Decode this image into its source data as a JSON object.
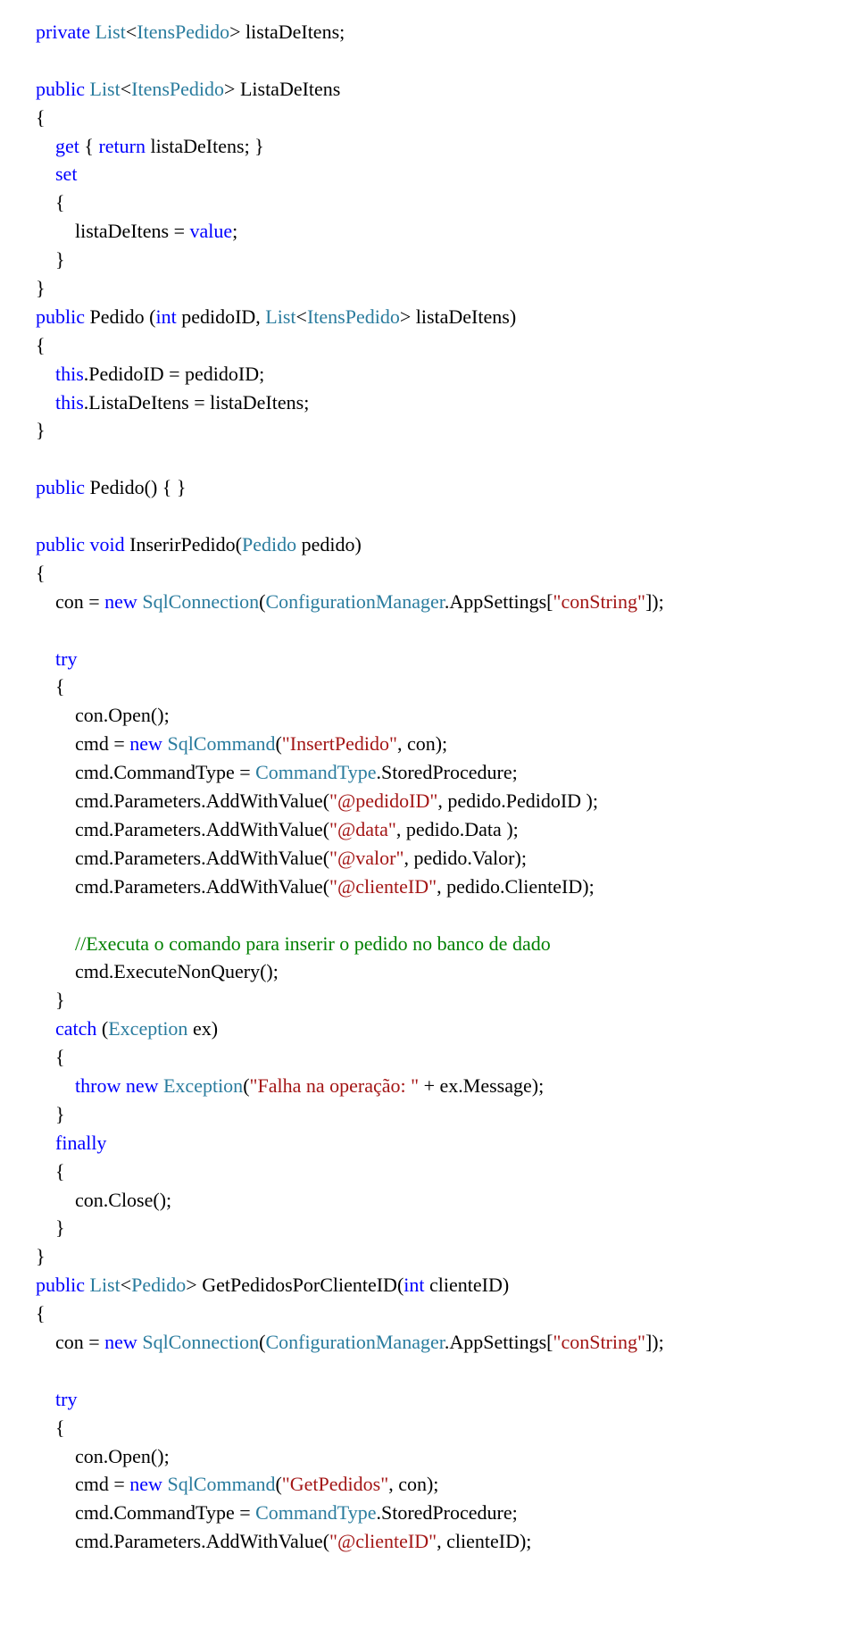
{
  "t": {
    "l1a": "private",
    "l1b": " List",
    "l1c": "<",
    "l1d": "ItensPedido",
    "l1e": "> listaDeItens; ",
    "l3a": "public",
    "l3b": " List",
    "l3c": "<",
    "l3d": "ItensPedido",
    "l3e": "> ListaDeItens ",
    "l4": "{ ",
    "l5a": "    get",
    "l5b": " { ",
    "l5c": "return",
    "l5d": " listaDeItens; } ",
    "l6a": "    set",
    "l7": "    { ",
    "l8a": "        listaDeItens = ",
    "l8b": "value",
    "l8c": "; ",
    "l9": "    } ",
    "l10": "} ",
    "l11a": "public",
    "l11b": " Pedido (",
    "l11c": "int",
    "l11d": " pedidoID, ",
    "l11e": "List",
    "l11f": "<",
    "l11g": "ItensPedido",
    "l11h": "> listaDeItens) ",
    "l12": "{ ",
    "l13a": "    this",
    "l13b": ".PedidoID = pedidoID; ",
    "l14a": "    this",
    "l14b": ".ListaDeItens = listaDeItens; ",
    "l15": "} ",
    "l17a": "public",
    "l17b": " Pedido() { } ",
    "l19a": "public",
    "l19b": " ",
    "l19c": "void",
    "l19d": " InserirPedido(",
    "l19e": "Pedido",
    "l19f": " pedido) ",
    "l20": "{ ",
    "l21a": "    con = ",
    "l21b": "new",
    "l21c": " SqlConnection",
    "l21d": "(",
    "l21e": "ConfigurationManager",
    "l21f": ".AppSettings[",
    "l21g": "\"conString\"",
    "l21h": "]); ",
    "l23a": "    try",
    "l24": "    { ",
    "l25": "        con.Open(); ",
    "l26a": "        cmd = ",
    "l26b": "new",
    "l26c": " SqlCommand",
    "l26d": "(",
    "l26e": "\"InsertPedido\"",
    "l26f": ", con); ",
    "l27a": "        cmd.CommandType = ",
    "l27b": "CommandType",
    "l27c": ".StoredProcedure; ",
    "l28a": "        cmd.Parameters.AddWithValue(",
    "l28b": "\"@pedidoID\"",
    "l28c": ", pedido.PedidoID ); ",
    "l29a": "        cmd.Parameters.AddWithValue(",
    "l29b": "\"@data\"",
    "l29c": ", pedido.Data ); ",
    "l30a": "        cmd.Parameters.AddWithValue(",
    "l30b": "\"@valor\"",
    "l30c": ", pedido.Valor); ",
    "l31a": "        cmd.Parameters.AddWithValue(",
    "l31b": "\"@clienteID\"",
    "l31c": ", pedido.ClienteID); ",
    "l33": "        //Executa o comando para inserir o pedido no banco de dado ",
    "l34": "        cmd.ExecuteNonQuery(); ",
    "l35": "    } ",
    "l36a": "    catch",
    "l36b": " (",
    "l36c": "Exception",
    "l36d": " ex) ",
    "l37": "    { ",
    "l38a": "        throw",
    "l38b": " ",
    "l38c": "new",
    "l38d": " Exception",
    "l38e": "(",
    "l38f": "\"Falha na operação: \"",
    "l38g": " + ex.Message); ",
    "l39": "    } ",
    "l40a": "    finally",
    "l41": "    { ",
    "l42": "        con.Close(); ",
    "l43": "    } ",
    "l44": "} ",
    "l45a": "public",
    "l45b": " List",
    "l45c": "<",
    "l45d": "Pedido",
    "l45e": "> GetPedidosPorClienteID(",
    "l45f": "int",
    "l45g": " clienteID) ",
    "l46": "{ ",
    "l47a": "    con = ",
    "l47b": "new",
    "l47c": " SqlConnection",
    "l47d": "(",
    "l47e": "ConfigurationManager",
    "l47f": ".AppSettings[",
    "l47g": "\"conString\"",
    "l47h": "]); ",
    "l49a": "    try",
    "l50": "    { ",
    "l51": "        con.Open(); ",
    "l52a": "        cmd = ",
    "l52b": "new",
    "l52c": " SqlCommand",
    "l52d": "(",
    "l52e": "\"GetPedidos\"",
    "l52f": ", con); ",
    "l53a": "        cmd.CommandType = ",
    "l53b": "CommandType",
    "l53c": ".StoredProcedure; ",
    "l54a": "        cmd.Parameters.AddWithValue(",
    "l54b": "\"@clienteID\"",
    "l54c": ", clienteID); "
  }
}
